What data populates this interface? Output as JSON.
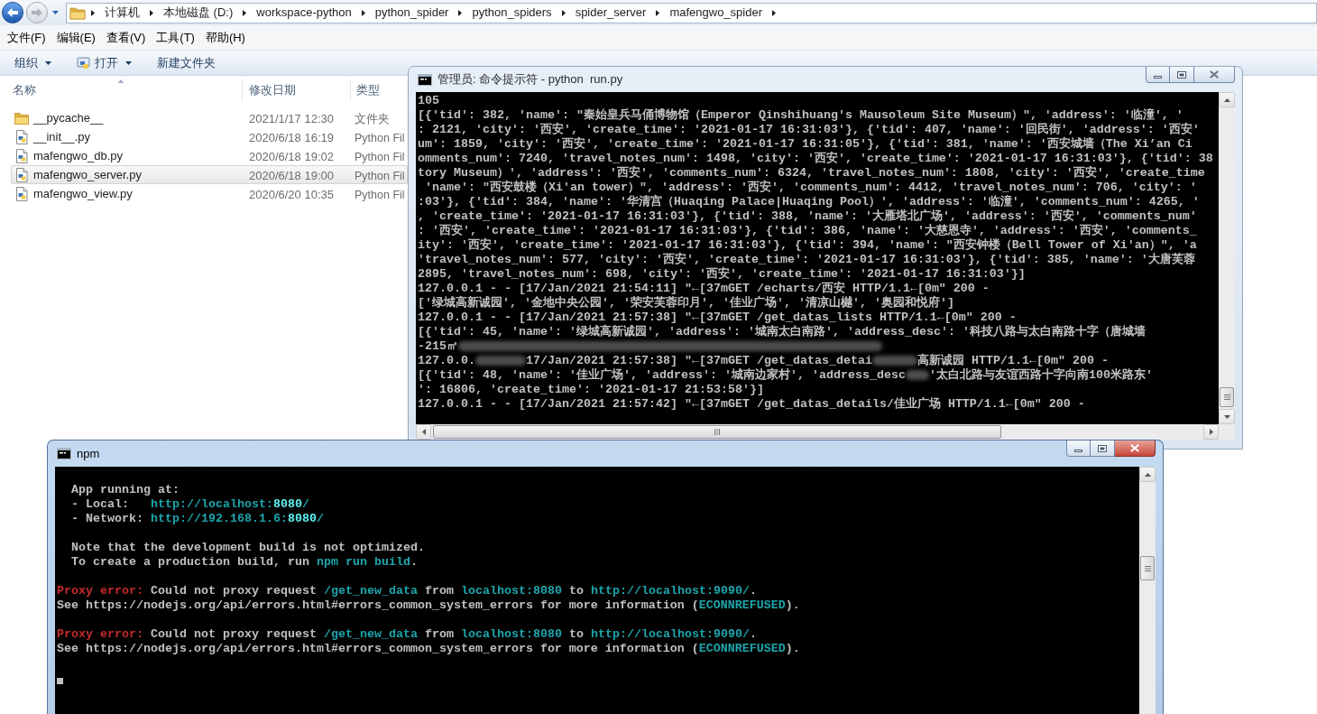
{
  "explorer": {
    "breadcrumb": [
      "计算机",
      "本地磁盘 (D:)",
      "workspace-python",
      "python_spider",
      "python_spiders",
      "spider_server",
      "mafengwo_spider"
    ],
    "menu": [
      "文件(F)",
      "编辑(E)",
      "查看(V)",
      "工具(T)",
      "帮助(H)"
    ],
    "toolbar": [
      {
        "label": "组织",
        "has_icon": false,
        "dropdown": true
      },
      {
        "label": "打开",
        "has_icon": true,
        "dropdown": true
      },
      {
        "label": "新建文件夹",
        "has_icon": false,
        "dropdown": false
      }
    ],
    "columns": [
      {
        "label": "名称",
        "sorted": true
      },
      {
        "label": "修改日期",
        "sorted": false
      },
      {
        "label": "类型",
        "sorted": false
      }
    ],
    "files": [
      {
        "kind": "folder",
        "name": "__pycache__",
        "modified": "2021/1/17 12:30",
        "type": "文件夹",
        "selected": false
      },
      {
        "kind": "file",
        "name": "__init__.py",
        "modified": "2020/6/18 16:19",
        "type": "Python Fil",
        "selected": false
      },
      {
        "kind": "file",
        "name": "mafengwo_db.py",
        "modified": "2020/6/18 19:02",
        "type": "Python Fil",
        "selected": false
      },
      {
        "kind": "file",
        "name": "mafengwo_server.py",
        "modified": "2020/6/18 19:00",
        "type": "Python Fil",
        "selected": true
      },
      {
        "kind": "file",
        "name": "mafengwo_view.py",
        "modified": "2020/6/20 10:35",
        "type": "Python Fil",
        "selected": false
      }
    ]
  },
  "console_windows": [
    {
      "title": "管理员: 命令提示符 - python  run.py",
      "active": false,
      "cursor": false,
      "blocks": [
        [
          {
            "parts": [
              {
                "kind": "plain",
                "text": "105"
              }
            ]
          },
          {
            "parts": [
              {
                "kind": "plain",
                "text": "[{'tid': 382, 'name': \"秦始皇兵马俑博物馆（Emperor Qinshihuang's Mausoleum Site Museum）\", 'address': '临潼', '"
              }
            ]
          },
          {
            "parts": [
              {
                "kind": "plain",
                "text": ": 2121, 'city': '西安', 'create_time': '2021-01-17 16:31:03'}, {'tid': 407, 'name': '回民街', 'address': '西安'"
              }
            ]
          },
          {
            "parts": [
              {
                "kind": "plain",
                "text": "um': 1859, 'city': '西安', 'create_time': '2021-01-17 16:31:05'}, {'tid': 381, 'name': '西安城墙（The Xi’an Ci"
              }
            ]
          },
          {
            "parts": [
              {
                "kind": "plain",
                "text": "omments_num': 7240, 'travel_notes_num': 1498, 'city': '西安', 'create_time': '2021-01-17 16:31:03'}, {'tid': 38"
              }
            ]
          },
          {
            "parts": [
              {
                "kind": "plain",
                "text": "tory Museum）', 'address': '西安', 'comments_num': 6324, 'travel_notes_num': 1808, 'city': '西安', 'create_time"
              }
            ]
          },
          {
            "parts": [
              {
                "kind": "plain",
                "text": " 'name': \"西安鼓楼（Xi'an tower）\", 'address': '西安', 'comments_num': 4412, 'travel_notes_num': 706, 'city': '"
              }
            ]
          },
          {
            "parts": [
              {
                "kind": "plain",
                "text": ":03'}, {'tid': 384, 'name': '华清宫（Huaqing Palace|Huaqing Pool）', 'address': '临潼', 'comments_num': 4265, '"
              }
            ]
          },
          {
            "parts": [
              {
                "kind": "plain",
                "text": ", 'create_time': '2021-01-17 16:31:03'}, {'tid': 388, 'name': '大雁塔北广场', 'address': '西安', 'comments_num'"
              }
            ]
          },
          {
            "parts": [
              {
                "kind": "plain",
                "text": ": '西安', 'create_time': '2021-01-17 16:31:03'}, {'tid': 386, 'name': '大慈恩寺', 'address': '西安', 'comments_"
              }
            ]
          },
          {
            "parts": [
              {
                "kind": "plain",
                "text": "ity': '西安', 'create_time': '2021-01-17 16:31:03'}, {'tid': 394, 'name': \"西安钟楼（Bell Tower of Xi'an）\", 'a"
              }
            ]
          },
          {
            "parts": [
              {
                "kind": "plain",
                "text": "'travel_notes_num': 577, 'city': '西安', 'create_time': '2021-01-17 16:31:03'}, {'tid': 385, 'name': '大唐芙蓉"
              }
            ]
          },
          {
            "parts": [
              {
                "kind": "plain",
                "text": "2895, 'travel_notes_num': 698, 'city': '西安', 'create_time': '2021-01-17 16:31:03'}]"
              }
            ]
          },
          {
            "parts": [
              {
                "kind": "plain",
                "text": "127.0.0.1 - - [17/Jan/2021 21:54:11] \"←[37mGET /echarts/西安 HTTP/1.1←[0m\" 200 -"
              }
            ]
          },
          {
            "parts": [
              {
                "kind": "plain",
                "text": "['绿城高新诚园', '金地中央公园', '荣安芙蓉印月', '佳业广场', '清凉山樾', '奥园和悦府']"
              }
            ]
          },
          {
            "parts": [
              {
                "kind": "plain",
                "text": "127.0.0.1 - - [17/Jan/2021 21:57:38] \"←[37mGET /get_datas_lists HTTP/1.1←[0m\" 200 -"
              }
            ]
          },
          {
            "parts": [
              {
                "kind": "plain",
                "text": "[{'tid': 45, 'name': '绿城高新诚园', 'address': '城南太白南路', 'address_desc': '科技八路与太白南路十字（唐城墙"
              }
            ]
          },
          {
            "parts": [
              {
                "kind": "plain",
                "text": "-215㎡"
              },
              {
                "kind": "smudge"
              }
            ]
          },
          {
            "parts": [
              {
                "kind": "plain",
                "text": "127.0.0."
              },
              {
                "kind": "smudge"
              },
              {
                "kind": "plain",
                "text": "17/Jan/2021 21:57:38] \"←[37mGET /get_datas_detai"
              },
              {
                "kind": "smudge"
              },
              {
                "kind": "plain",
                "text": "高新诚园 HTTP/1.1←[0m\" 200 -"
              }
            ]
          },
          {
            "parts": [
              {
                "kind": "plain",
                "text": "[{'tid': 48, 'name': '佳业广场', 'address': '城南边家村', 'address_desc"
              },
              {
                "kind": "smudge"
              },
              {
                "kind": "plain",
                "text": "'太白北路与友谊西路十字向南100米路东'"
              }
            ]
          },
          {
            "parts": [
              {
                "kind": "plain",
                "text": "': 16806, 'create_time': '2021-01-17 21:53:58'}]"
              }
            ]
          },
          {
            "parts": [
              {
                "kind": "plain",
                "text": "127.0.0.1 - - [17/Jan/2021 21:57:42] \"←[37mGET /get_datas_details/佳业广场 HTTP/1.1←[0m\" 200 -"
              }
            ]
          }
        ]
      ]
    },
    {
      "title": "npm",
      "active": true,
      "cursor": true,
      "blocks": [
        [
          {
            "parts": [
              {
                "kind": "plain",
                "text": "  App running at:"
              }
            ]
          },
          {
            "parts": [
              {
                "kind": "plain",
                "text": "  - Local:   "
              },
              {
                "kind": "accent",
                "text": "http://localhost:"
              },
              {
                "kind": "bright",
                "text": "8080"
              },
              {
                "kind": "accent",
                "text": "/"
              }
            ]
          },
          {
            "parts": [
              {
                "kind": "plain",
                "text": "  - Network: "
              },
              {
                "kind": "accent",
                "text": "http://192.168.1.6:"
              },
              {
                "kind": "bright",
                "text": "8080"
              },
              {
                "kind": "accent",
                "text": "/"
              }
            ]
          }
        ],
        [
          {
            "parts": [
              {
                "kind": "plain",
                "text": "  Note that the development build is not optimized."
              }
            ]
          },
          {
            "parts": [
              {
                "kind": "plain",
                "text": "  To create a production build, run "
              },
              {
                "kind": "accent",
                "text": "npm run build"
              },
              {
                "kind": "plain",
                "text": "."
              }
            ]
          }
        ],
        [
          {
            "parts": [
              {
                "kind": "error",
                "text": "Proxy error:"
              },
              {
                "kind": "plain",
                "text": " Could not proxy request "
              },
              {
                "kind": "accent",
                "text": "/get_new_data"
              },
              {
                "kind": "plain",
                "text": " from "
              },
              {
                "kind": "accent",
                "text": "localhost:8080"
              },
              {
                "kind": "plain",
                "text": " to "
              },
              {
                "kind": "accent",
                "text": "http://localhost:9090/"
              },
              {
                "kind": "plain",
                "text": "."
              }
            ]
          },
          {
            "parts": [
              {
                "kind": "plain",
                "text": "See https://nodejs.org/api/errors.html#errors_common_system_errors for more information ("
              },
              {
                "kind": "accent",
                "text": "ECONNREFUSED"
              },
              {
                "kind": "plain",
                "text": ")."
              }
            ]
          }
        ],
        [
          {
            "parts": [
              {
                "kind": "error",
                "text": "Proxy error:"
              },
              {
                "kind": "plain",
                "text": " Could not proxy request "
              },
              {
                "kind": "accent",
                "text": "/get_new_data"
              },
              {
                "kind": "plain",
                "text": " from "
              },
              {
                "kind": "accent",
                "text": "localhost:8080"
              },
              {
                "kind": "plain",
                "text": " to "
              },
              {
                "kind": "accent",
                "text": "http://localhost:9090/"
              },
              {
                "kind": "plain",
                "text": "."
              }
            ]
          },
          {
            "parts": [
              {
                "kind": "plain",
                "text": "See https://nodejs.org/api/errors.html#errors_common_system_errors for more information ("
              },
              {
                "kind": "accent",
                "text": "ECONNREFUSED"
              },
              {
                "kind": "plain",
                "text": ")."
              }
            ]
          }
        ]
      ]
    }
  ]
}
